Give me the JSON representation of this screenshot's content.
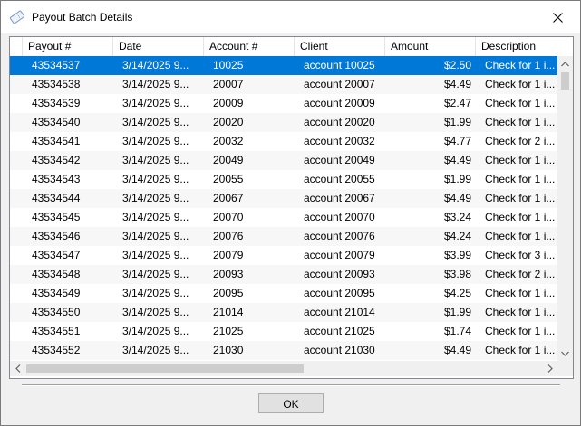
{
  "window": {
    "title": "Payout Batch Details",
    "title_icon": "ticket-icon",
    "close_icon": "close-icon"
  },
  "grid": {
    "columns": [
      "Payout #",
      "Date",
      "Account #",
      "Client",
      "Amount",
      "Description"
    ],
    "selected_row": 0,
    "rows": [
      {
        "payout": "43534537",
        "date": "3/14/2025 9...",
        "account": "10025",
        "client": "account 10025",
        "amount": "$2.50",
        "description": "Check for 1 i..."
      },
      {
        "payout": "43534538",
        "date": "3/14/2025 9...",
        "account": "20007",
        "client": "account 20007",
        "amount": "$4.49",
        "description": "Check for 1 i..."
      },
      {
        "payout": "43534539",
        "date": "3/14/2025 9...",
        "account": "20009",
        "client": "account 20009",
        "amount": "$2.47",
        "description": "Check for 1 i..."
      },
      {
        "payout": "43534540",
        "date": "3/14/2025 9...",
        "account": "20020",
        "client": "account 20020",
        "amount": "$1.99",
        "description": "Check for 1 i..."
      },
      {
        "payout": "43534541",
        "date": "3/14/2025 9...",
        "account": "20032",
        "client": "account 20032",
        "amount": "$4.77",
        "description": "Check for 2 i..."
      },
      {
        "payout": "43534542",
        "date": "3/14/2025 9...",
        "account": "20049",
        "client": "account 20049",
        "amount": "$4.49",
        "description": "Check for 1 i..."
      },
      {
        "payout": "43534543",
        "date": "3/14/2025 9...",
        "account": "20055",
        "client": "account 20055",
        "amount": "$1.99",
        "description": "Check for 1 i..."
      },
      {
        "payout": "43534544",
        "date": "3/14/2025 9...",
        "account": "20067",
        "client": "account 20067",
        "amount": "$4.49",
        "description": "Check for 1 i..."
      },
      {
        "payout": "43534545",
        "date": "3/14/2025 9...",
        "account": "20070",
        "client": "account 20070",
        "amount": "$3.24",
        "description": "Check for 1 i..."
      },
      {
        "payout": "43534546",
        "date": "3/14/2025 9...",
        "account": "20076",
        "client": "account 20076",
        "amount": "$4.24",
        "description": "Check for 1 i..."
      },
      {
        "payout": "43534547",
        "date": "3/14/2025 9...",
        "account": "20079",
        "client": "account 20079",
        "amount": "$3.99",
        "description": "Check for 3 i..."
      },
      {
        "payout": "43534548",
        "date": "3/14/2025 9...",
        "account": "20093",
        "client": "account 20093",
        "amount": "$3.98",
        "description": "Check for 2 i..."
      },
      {
        "payout": "43534549",
        "date": "3/14/2025 9...",
        "account": "20095",
        "client": "account 20095",
        "amount": "$4.25",
        "description": "Check for 1 i..."
      },
      {
        "payout": "43534550",
        "date": "3/14/2025 9...",
        "account": "21014",
        "client": "account 21014",
        "amount": "$1.99",
        "description": "Check for 1 i..."
      },
      {
        "payout": "43534551",
        "date": "3/14/2025 9...",
        "account": "21025",
        "client": "account 21025",
        "amount": "$1.74",
        "description": "Check for 1 i..."
      },
      {
        "payout": "43534552",
        "date": "3/14/2025 9...",
        "account": "21030",
        "client": "account 21030",
        "amount": "$4.49",
        "description": "Check for 1 i..."
      }
    ]
  },
  "footer": {
    "ok_label": "OK"
  },
  "colors": {
    "selection": "#0078d7",
    "alt_row": "#f7f7f7",
    "window_bg": "#f0f0f0"
  }
}
